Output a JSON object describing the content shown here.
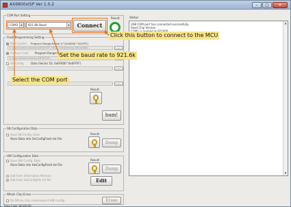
{
  "window": {
    "title": "AX6800xISP Ver 1.0.2",
    "minimize": "–",
    "maximize": "□",
    "close": "✕"
  },
  "com_port": {
    "group_label": "COM Port Setting",
    "port": "COM1",
    "baud": "921.6K Baud",
    "connect_label": "Connect",
    "result_label": "Result:",
    "indicator_color": "#1fa02f"
  },
  "flash": {
    "group_label": "Flash Programming Setting",
    "boot_loader_label": "Boot Loader",
    "program_range": "Program Range:Sector 0^[0x0000^0x2FFF]",
    "path1": "C:\\Users\\Administrator\\DESKTOP-73B4L72D\\Desktop-MN-AX680...",
    "feature_label": "Feature Code",
    "feature_range": "Program Range:Sector 1...",
    "path2": "C:\\Users\\Administrator\\DESKTOP-...",
    "on_config_label": "On Config",
    "on_config_range": "Data (Sector 10, 0x0F000^0x0FFFF)",
    "path3": "C:\\...",
    "path4": "...\\tasks\\...\\flash.bin",
    "browse": "...",
    "result_label": "Result:",
    "burn_label": "bum!"
  },
  "sn_config": {
    "group_label": "SN Configuration Data",
    "save_label": "Save SN Config. Data",
    "store_label": "Store Data into OnConfigFlash txt File",
    "result_label": "Result:",
    "dump_label": "Dump"
  },
  "hw_config": {
    "group_label": "HW Configuration Data",
    "save_label": "Save HW Config. Data",
    "store_label": "Store Data into HwConfigFlash txt File",
    "result_label": "Result:",
    "dump_label": "Dump",
    "edit_from_memory": "Edit from Information Memory",
    "edit_from_file": "Edit from HwConfigFile txt file",
    "edit_label": "Edit"
  },
  "erase": {
    "group_label": "Whole Chip Erase",
    "checkbox_label": "Do Whole chip erase(expect HW config)",
    "result_label": "Result:",
    "erase_label": "Erase"
  },
  "time_cost": {
    "label": "Time Cost:",
    "value": "00:00:00"
  },
  "status": {
    "label": "Status",
    "lines": [
      "USB COM port has connected successfully.",
      "Read Chip Version",
      "COM1 is opened @ 921600"
    ]
  },
  "annotations": {
    "connect": "Click this button to connect to the MCU",
    "baud": "Set the baud rate to 921.6k",
    "com": "Select the COM port",
    "color": "#e8731a",
    "label_bg": "#f8e58a"
  }
}
